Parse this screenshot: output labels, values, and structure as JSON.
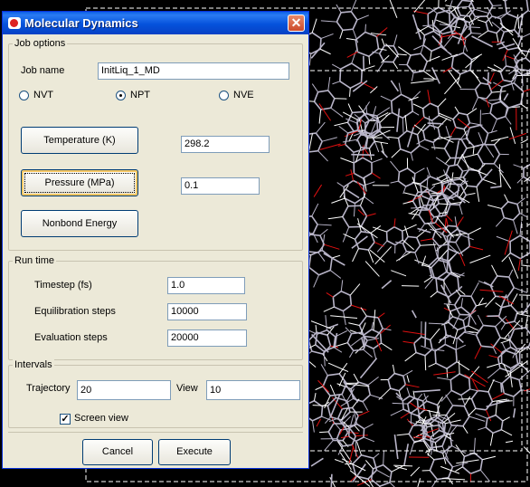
{
  "dialog": {
    "title": "Molecular Dynamics",
    "close_glyph": "✕"
  },
  "job_options": {
    "legend": "Job options",
    "job_name_label": "Job name",
    "job_name_value": "InitLiq_1_MD",
    "ensembles": [
      {
        "label": "NVT",
        "selected": false
      },
      {
        "label": "NPT",
        "selected": true
      },
      {
        "label": "NVE",
        "selected": false
      }
    ],
    "temperature_button": "Temperature (K)",
    "temperature_value": "298.2",
    "pressure_button": "Pressure (MPa)",
    "pressure_value": "0.1",
    "nonbond_button": "Nonbond Energy"
  },
  "run_time": {
    "legend": "Run time",
    "timestep_label": "Timestep (fs)",
    "timestep_value": "1.0",
    "equilibration_label": "Equilibration steps",
    "equilibration_value": "10000",
    "evaluation_label": "Evaluation steps",
    "evaluation_value": "20000"
  },
  "intervals": {
    "legend": "Intervals",
    "trajectory_label": "Trajectory",
    "trajectory_value": "20",
    "view_label": "View",
    "view_value": "10",
    "screen_view_label": "Screen view",
    "screen_view_checked": true,
    "check_glyph": "✓"
  },
  "footer": {
    "cancel_label": "Cancel",
    "execute_label": "Execute"
  },
  "colors": {
    "viewport_background": "#000000",
    "bond_carbon": "#b8b4c8",
    "bond_hydrogen": "#ffffff",
    "bond_oxygen": "#e01010",
    "title_bar": "#0552dc",
    "dialog_face": "#ece9d8"
  }
}
